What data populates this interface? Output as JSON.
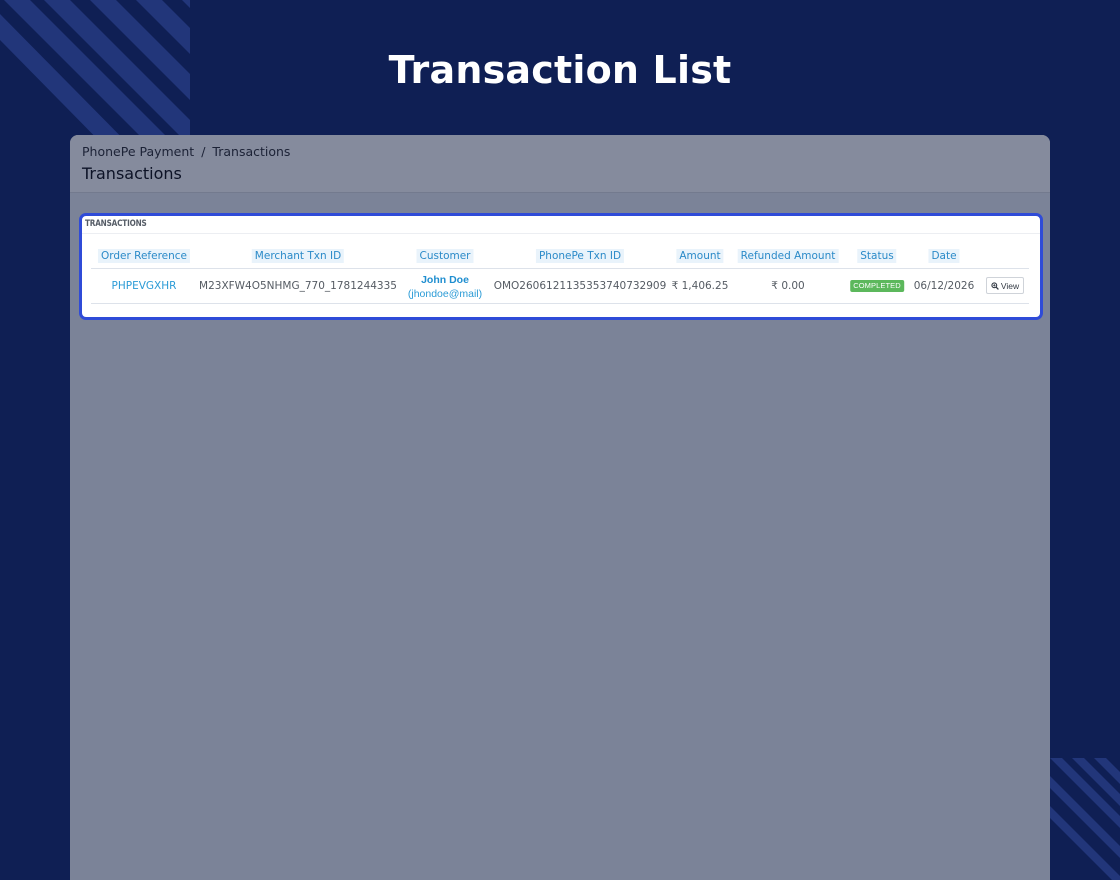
{
  "page": {
    "title": "Transaction List"
  },
  "app": {
    "breadcrumb": {
      "parent": "PhonePe Payment",
      "separator": "/",
      "current": "Transactions"
    },
    "header_title": "Transactions"
  },
  "panel": {
    "heading": "TRANSACTIONS",
    "columns": [
      "Order Reference",
      "Merchant Txn ID",
      "Customer",
      "PhonePe Txn ID",
      "Amount",
      "Refunded Amount",
      "Status",
      "Date"
    ],
    "rows": [
      {
        "order_reference": "PHPEVGXHR",
        "merchant_txn_id": "M23XFW4O5NHMG_770_1781244335",
        "customer_name": "John Doe",
        "customer_email": "(jhondoe@mail)",
        "phonepe_txn_id": "OMO2606121135353740732909",
        "amount": "₹ 1,406.25",
        "refunded_amount": "₹ 0.00",
        "status": "COMPLETED",
        "date": "06/12/2026",
        "action_label": "View"
      }
    ]
  },
  "icons": {
    "view": "zoom-in-icon"
  },
  "colors": {
    "background": "#0f1f54",
    "accent_border": "#2f4bd8",
    "link": "#2b9bd6",
    "status_completed": "#5cb85c"
  }
}
